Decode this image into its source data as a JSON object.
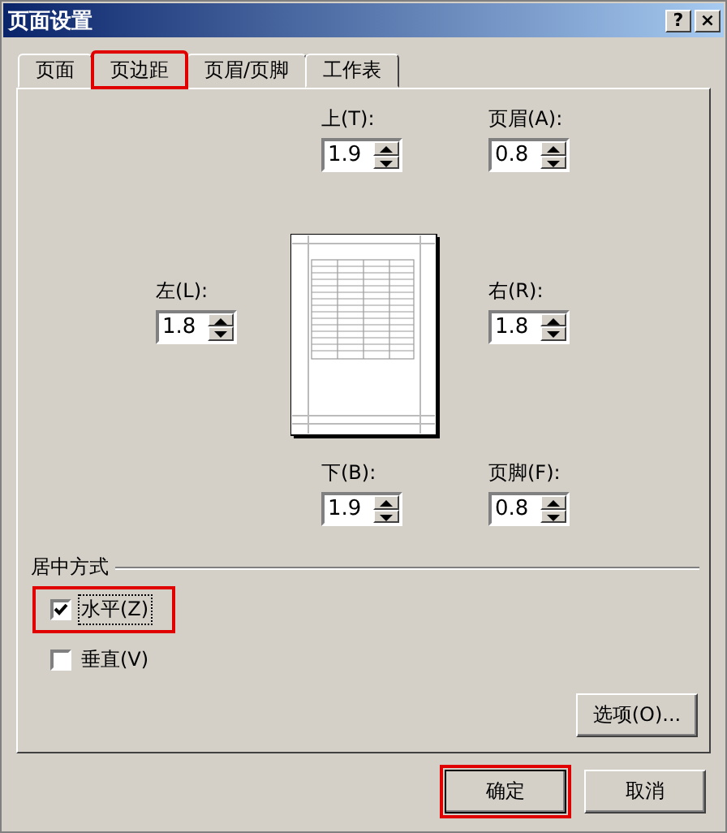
{
  "window": {
    "title": "页面设置",
    "controls": [
      "?",
      "×"
    ]
  },
  "tabs": [
    {
      "label": "页面",
      "selected": false,
      "highlighted": false
    },
    {
      "label": "页边距",
      "selected": true,
      "highlighted": true
    },
    {
      "label": "页眉/页脚",
      "selected": false,
      "highlighted": false
    },
    {
      "label": "工作表",
      "selected": false,
      "highlighted": false
    }
  ],
  "margins": {
    "top": {
      "label": "上(T):",
      "value": "1.9"
    },
    "header": {
      "label": "页眉(A):",
      "value": "0.8"
    },
    "left": {
      "label": "左(L):",
      "value": "1.8"
    },
    "right": {
      "label": "右(R):",
      "value": "1.8"
    },
    "bottom": {
      "label": "下(B):",
      "value": "1.9"
    },
    "footer": {
      "label": "页脚(F):",
      "value": "0.8"
    }
  },
  "center_on_page": {
    "title": "居中方式",
    "options": [
      {
        "label": "水平(Z)",
        "checked": true,
        "highlighted": true,
        "focused": true
      },
      {
        "label": "垂直(V)",
        "checked": false,
        "highlighted": false,
        "focused": false
      }
    ]
  },
  "options_button": "选项(O)...",
  "buttons": [
    {
      "label": "确定",
      "highlighted": true
    },
    {
      "label": "取消",
      "highlighted": false
    }
  ]
}
